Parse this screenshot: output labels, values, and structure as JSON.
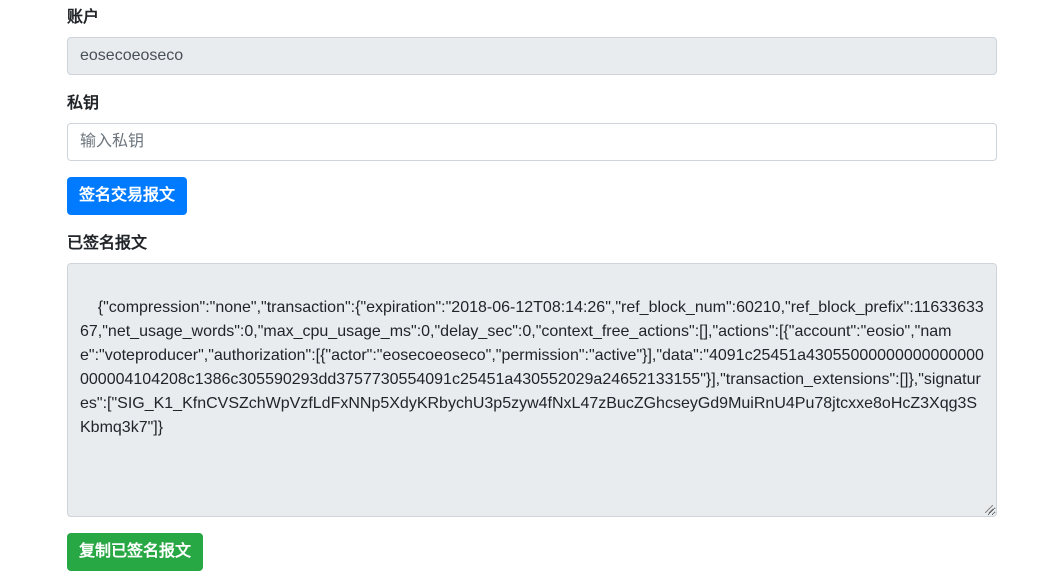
{
  "account": {
    "label": "账户",
    "value": "eosecoeoseco"
  },
  "private_key": {
    "label": "私钥",
    "placeholder": "输入私钥",
    "value": ""
  },
  "sign_button": {
    "label": "签名交易报文"
  },
  "signed": {
    "label": "已签名报文",
    "value": "{\"compression\":\"none\",\"transaction\":{\"expiration\":\"2018-06-12T08:14:26\",\"ref_block_num\":60210,\"ref_block_prefix\":1163363367,\"net_usage_words\":0,\"max_cpu_usage_ms\":0,\"delay_sec\":0,\"context_free_actions\":[],\"actions\":[{\"account\":\"eosio\",\"name\":\"voteproducer\",\"authorization\":[{\"actor\":\"eosecoeoseco\",\"permission\":\"active\"}],\"data\":\"4091c25451a43055000000000000000000004104208c1386c305590293dd3757730554091c25451a430552029a24652133155\"}],\"transaction_extensions\":[]},\"signatures\":[\"SIG_K1_KfnCVSZchWpVzfLdFxNNp5XdyKRbychU3p5zyw4fNxL47zBucZGhcseyGd9MuiRnU4Pu78jtcxxe8oHcZ3Xqg3SKbmq3k7\"]}"
  },
  "copy_button": {
    "label": "复制已签名报文"
  },
  "colors": {
    "primary": "#007bff",
    "success": "#28a745",
    "readonly_bg": "#e9ecef",
    "border": "#ced4da"
  }
}
